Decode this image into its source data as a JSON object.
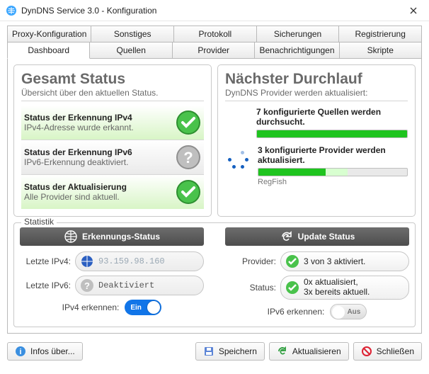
{
  "window": {
    "title": "DynDNS Service 3.0 - Konfiguration"
  },
  "tabsTop": {
    "t0": "Proxy-Konfiguration",
    "t1": "Sonstiges",
    "t2": "Protokoll",
    "t3": "Sicherungen",
    "t4": "Registrierung"
  },
  "tabsBottom": {
    "t0": "Dashboard",
    "t1": "Quellen",
    "t2": "Provider",
    "t3": "Benachrichtigungen",
    "t4": "Skripte"
  },
  "overall": {
    "title": "Gesamt Status",
    "subtitle": "Übersicht über den aktuellen Status.",
    "row1_title": "Status der Erkennung IPv4",
    "row1_desc": "IPv4-Adresse wurde erkannt.",
    "row2_title": "Status der Erkennung IPv6",
    "row2_desc": "IPv6-Erkennung deaktiviert.",
    "row3_title": "Status der Aktualisierung",
    "row3_desc": "Alle Provider sind aktuell."
  },
  "nextrun": {
    "title": "Nächster Durchlauf",
    "subtitle": "DynDNS Provider werden aktualisiert:",
    "sources_label": "7 konfigurierte Quellen werden durchsucht.",
    "providers_label": "3 konfigurierte Provider werden aktualisiert.",
    "provider_current": "RegFish"
  },
  "stats": {
    "legend": "Statistik",
    "detect_header": "Erkennungs-Status",
    "update_header": "Update Status",
    "last_ipv4_label": "Letzte IPv4:",
    "last_ipv4_value": "93.159.98.160",
    "last_ipv6_label": "Letzte IPv6:",
    "last_ipv6_value": "Deaktiviert",
    "provider_label": "Provider:",
    "provider_value": "3 von 3 aktiviert.",
    "status_label": "Status:",
    "status_value_line1": "0x aktualisiert,",
    "status_value_line2": "3x bereits aktuell.",
    "detect_ipv4_label": "IPv4 erkennen:",
    "detect_ipv4_state": "Ein",
    "detect_ipv6_label": "IPv6 erkennen:",
    "detect_ipv6_state": "Aus"
  },
  "footer": {
    "about": "Infos über...",
    "save": "Speichern",
    "refresh": "Aktualisieren",
    "close": "Schließen"
  }
}
